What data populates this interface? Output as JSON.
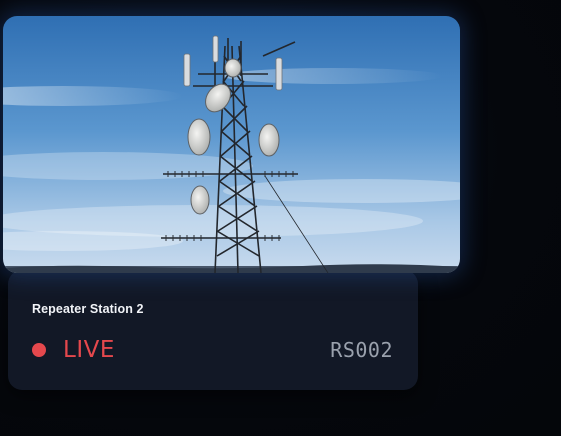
{
  "station": {
    "name": "Repeater Station 2",
    "status_label": "LIVE",
    "code": "RS002",
    "image_subject": "communication tower with antennas and dishes against blue sky"
  },
  "colors": {
    "live": "#e5484d",
    "card_background": "#121826",
    "code_text": "#9aa1ad",
    "name_text": "#f1f3f7"
  },
  "icons": {
    "status_indicator": "live-dot-icon"
  }
}
